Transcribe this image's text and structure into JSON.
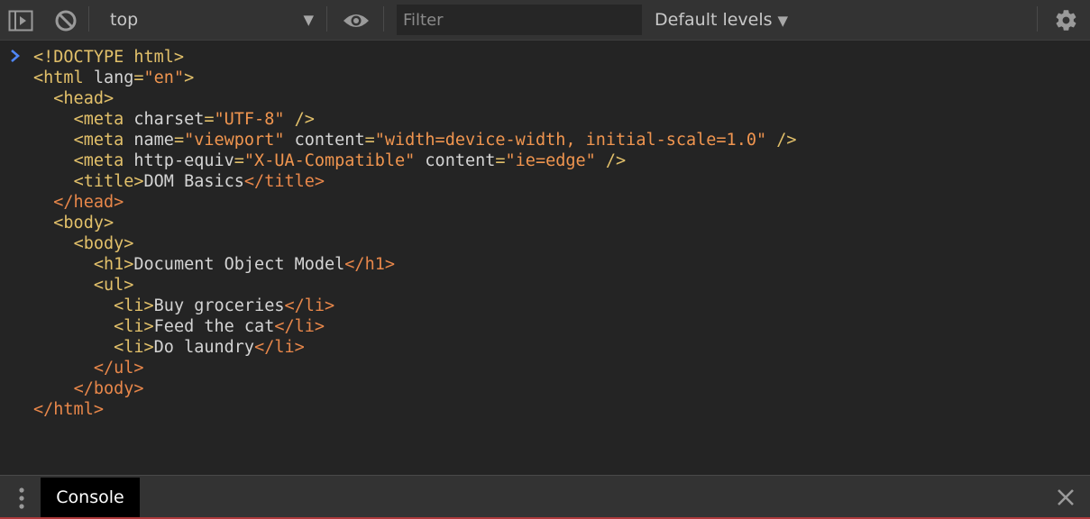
{
  "toolbar": {
    "sidebar_toggle_icon": "sidebar-toggle-icon",
    "clear_icon": "block-icon",
    "context": {
      "selected": "top"
    },
    "eye_icon": "eye-icon",
    "filter": {
      "placeholder": "Filter",
      "value": ""
    },
    "levels": {
      "label": "Default levels"
    },
    "settings_icon": "gear-icon"
  },
  "console": {
    "prompt_icon": "chevron-right-icon",
    "lines": [
      {
        "indent": 0,
        "parts": [
          [
            "tag",
            "<!DOCTYPE html>"
          ]
        ]
      },
      {
        "indent": 0,
        "parts": [
          [
            "tag",
            "<html "
          ],
          [
            "attr-name",
            "lang"
          ],
          [
            "tag",
            "="
          ],
          [
            "attr-val",
            "\"en\""
          ],
          [
            "tag",
            ">"
          ]
        ]
      },
      {
        "indent": 1,
        "parts": [
          [
            "tag",
            "<head>"
          ]
        ]
      },
      {
        "indent": 2,
        "parts": [
          [
            "tag",
            "<meta "
          ],
          [
            "attr-name",
            "charset"
          ],
          [
            "tag",
            "="
          ],
          [
            "attr-val",
            "\"UTF-8\""
          ],
          [
            "tag",
            " />"
          ]
        ]
      },
      {
        "indent": 2,
        "parts": [
          [
            "tag",
            "<meta "
          ],
          [
            "attr-name",
            "name"
          ],
          [
            "tag",
            "="
          ],
          [
            "attr-val",
            "\"viewport\""
          ],
          [
            "attr-name",
            " content"
          ],
          [
            "tag",
            "="
          ],
          [
            "attr-val",
            "\"width=device-width, initial-scale=1.0\""
          ],
          [
            "tag",
            " />"
          ]
        ]
      },
      {
        "indent": 2,
        "parts": [
          [
            "tag",
            "<meta "
          ],
          [
            "attr-name",
            "http-equiv"
          ],
          [
            "tag",
            "="
          ],
          [
            "attr-val",
            "\"X-UA-Compatible\""
          ],
          [
            "attr-name",
            " content"
          ],
          [
            "tag",
            "="
          ],
          [
            "attr-val",
            "\"ie=edge\""
          ],
          [
            "tag",
            " />"
          ]
        ]
      },
      {
        "indent": 2,
        "parts": [
          [
            "tag",
            "<title>"
          ],
          [
            "text",
            "DOM Basics"
          ],
          [
            "close-tag",
            "</title>"
          ]
        ]
      },
      {
        "indent": 1,
        "parts": [
          [
            "close-tag",
            "</head>"
          ]
        ]
      },
      {
        "indent": 1,
        "parts": [
          [
            "tag",
            "<body>"
          ]
        ]
      },
      {
        "indent": 2,
        "parts": [
          [
            "tag",
            "<body>"
          ]
        ]
      },
      {
        "indent": 3,
        "parts": [
          [
            "tag",
            "<h1>"
          ],
          [
            "text",
            "Document Object Model"
          ],
          [
            "close-tag",
            "</h1>"
          ]
        ]
      },
      {
        "indent": 3,
        "parts": [
          [
            "tag",
            "<ul>"
          ]
        ]
      },
      {
        "indent": 4,
        "parts": [
          [
            "tag",
            "<li>"
          ],
          [
            "text",
            "Buy groceries"
          ],
          [
            "close-tag",
            "</li>"
          ]
        ]
      },
      {
        "indent": 4,
        "parts": [
          [
            "tag",
            "<li>"
          ],
          [
            "text",
            "Feed the cat"
          ],
          [
            "close-tag",
            "</li>"
          ]
        ]
      },
      {
        "indent": 4,
        "parts": [
          [
            "tag",
            "<li>"
          ],
          [
            "text",
            "Do laundry"
          ],
          [
            "close-tag",
            "</li>"
          ]
        ]
      },
      {
        "indent": 3,
        "parts": [
          [
            "close-tag",
            "</ul>"
          ]
        ]
      },
      {
        "indent": 2,
        "parts": [
          [
            "close-tag",
            "</body>"
          ]
        ]
      },
      {
        "indent": 0,
        "parts": [
          [
            "close-tag",
            "</html>"
          ]
        ]
      }
    ]
  },
  "drawer": {
    "menu_icon": "vertical-dots-icon",
    "tab_label": "Console",
    "close_icon": "close-icon"
  },
  "colors": {
    "background": "#242424",
    "toolbar": "#333333",
    "tag": "#e2c06a",
    "close_tag": "#e8874a",
    "attr_value": "#f0954f",
    "text": "#d4d4d4",
    "prompt": "#4f86f7"
  }
}
